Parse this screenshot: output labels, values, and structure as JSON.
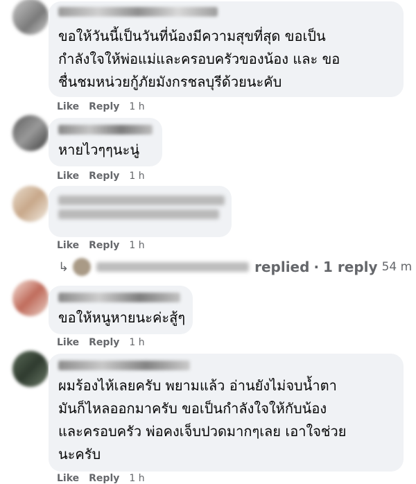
{
  "comments": [
    {
      "text": "ขอให้วันนี้เป็นวันที่น้องมีความสุขที่สุด ขอเป็น\nกำลังใจให้พ่อแม่และครอบครัวของน้อง และ ขอ\nชื่นชมหน่วยกู้ภัยมังกรชลบุรีด้วยนะคับ",
      "like": "Like",
      "reply": "Reply",
      "time": "1 h"
    },
    {
      "text": "หายไวๆๆนะนู่",
      "like": "Like",
      "reply": "Reply",
      "time": "1 h"
    },
    {
      "text": "",
      "like": "Like",
      "reply": "Reply",
      "time": "1 h"
    },
    {
      "text": "ขอให้หนูหายนะค่ะสู้ๆ",
      "like": "Like",
      "reply": "Reply",
      "time": "1 h"
    },
    {
      "text": "ผมร้องไห้เลยครับ พยามแล้ว อ่านยังไม่จบน้ำตา\nมันก็ไหลออกมาครับ ขอเป็นกำลังใจให้กับน้อง\nและครอบครัว พ่อคงเจ็บปวดมากๆเลย เอาใจช่วย\nนะครับ",
      "like": "Like",
      "reply": "Reply",
      "time": "1 h"
    }
  ],
  "reply_summary": {
    "replied": "replied",
    "dot": "·",
    "count": "1 reply",
    "time": "54 m"
  },
  "colors": {
    "bubble": "#f0f2f5",
    "meta": "#65676b",
    "text": "#050505"
  }
}
